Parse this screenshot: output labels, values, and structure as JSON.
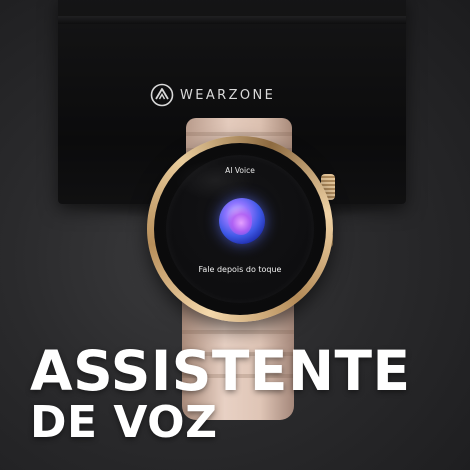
{
  "box": {
    "brand_name": "WEARZONE",
    "logo_icon": "wearzone-logo-icon"
  },
  "watch": {
    "screen_title": "AI Voice",
    "screen_subtitle": "Fale depois do toque",
    "orb_icon": "voice-assistant-orb-icon",
    "case_color": "#d8b583",
    "strap_color": "#dcc1b1"
  },
  "headline": {
    "line1": "ASSISTENTE",
    "line2": "DE VOZ",
    "color": "#ffffff"
  }
}
